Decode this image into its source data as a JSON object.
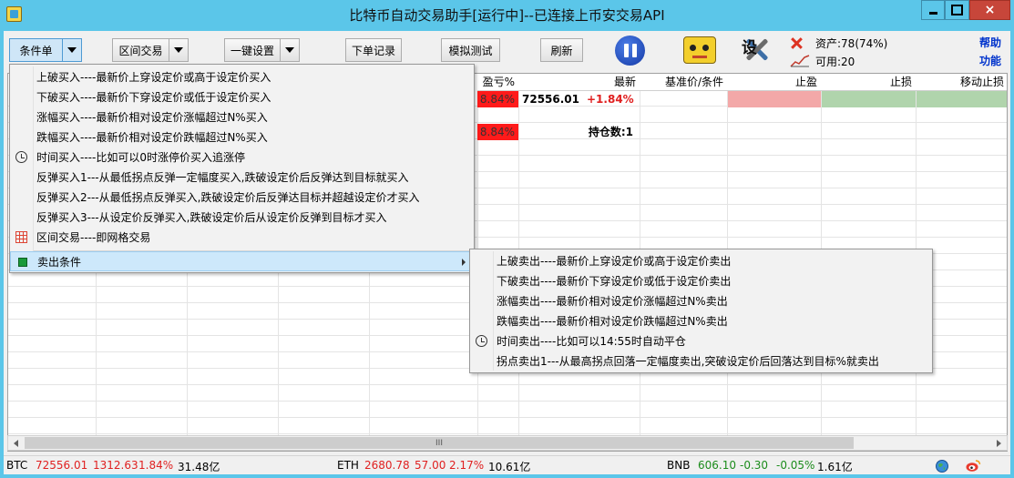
{
  "window": {
    "title": "比特币自动交易助手[运行中]--已连接上币安交易API",
    "close_label": "×"
  },
  "toolbar": {
    "condition_order": "条件单",
    "range_trade": "区间交易",
    "one_click_setup": "一键设置",
    "order_log": "下单记录",
    "simulate_test": "模拟测试",
    "refresh": "刷新",
    "settings_glyph": "设",
    "assets": "资产:78(74%)",
    "available": "可用:20",
    "help": "帮助",
    "functions": "功能"
  },
  "grid": {
    "headers": {
      "pnl_pct": "盈亏%",
      "latest": "最新",
      "base_price": "基准价/条件",
      "take_profit": "止盈",
      "stop_loss": "止损",
      "trailing_stop": "移动止损"
    },
    "row1": {
      "pnl": "8.84%",
      "latest": "72556.01",
      "change": "+1.84%"
    },
    "row3": {
      "pnl": "8.84%",
      "position_count": "持仓数:1"
    },
    "scroll_thumb": "III"
  },
  "buy_menu": {
    "items": [
      "上破买入----最新价上穿设定价或高于设定价买入",
      "下破买入----最新价下穿设定价或低于设定价买入",
      "涨幅买入----最新价相对设定价涨幅超过N%买入",
      "跌幅买入----最新价相对设定价跌幅超过N%买入",
      "时间买入----比如可以0时涨停价买入追涨停",
      "反弹买入1---从最低拐点反弹一定幅度买入,跌破设定价后反弹达到目标就买入",
      "反弹买入2---从最低拐点反弹买入,跌破设定价后反弹达目标并超越设定价才买入",
      "反弹买入3---从设定价反弹买入,跌破设定价后从设定价反弹到目标才买入",
      "区间交易----即网格交易"
    ],
    "sell_conditions": "卖出条件"
  },
  "sell_menu": {
    "items": [
      "上破卖出----最新价上穿设定价或高于设定价卖出",
      "下破卖出----最新价下穿设定价或低于设定价卖出",
      "涨幅卖出----最新价相对设定价涨幅超过N%卖出",
      "跌幅卖出----最新价相对设定价跌幅超过N%卖出",
      "时间卖出----比如可以14:55时自动平仓",
      "拐点卖出1---从最高拐点回落一定幅度卖出,突破设定价后回落达到目标%就卖出"
    ]
  },
  "status": {
    "btc": {
      "symbol": "BTC",
      "price": "72556.01",
      "change": "1312.63",
      "pct": "1.84%",
      "volume": "31.48亿"
    },
    "eth": {
      "symbol": "ETH",
      "price": "2680.78",
      "change": "57.00",
      "pct": "2.17%",
      "volume": "10.61亿"
    },
    "bnb": {
      "symbol": "BNB",
      "price": "606.10",
      "change": "-0.30",
      "pct": "-0.05%",
      "volume": "1.61亿"
    }
  },
  "colors": {
    "title_bar": "#5bc6e9",
    "loss_red": "#ff1a1a",
    "take_profit_pink": "#f3a8a8",
    "stop_loss_green": "#b0d4ac",
    "link_blue": "#0033cc"
  }
}
